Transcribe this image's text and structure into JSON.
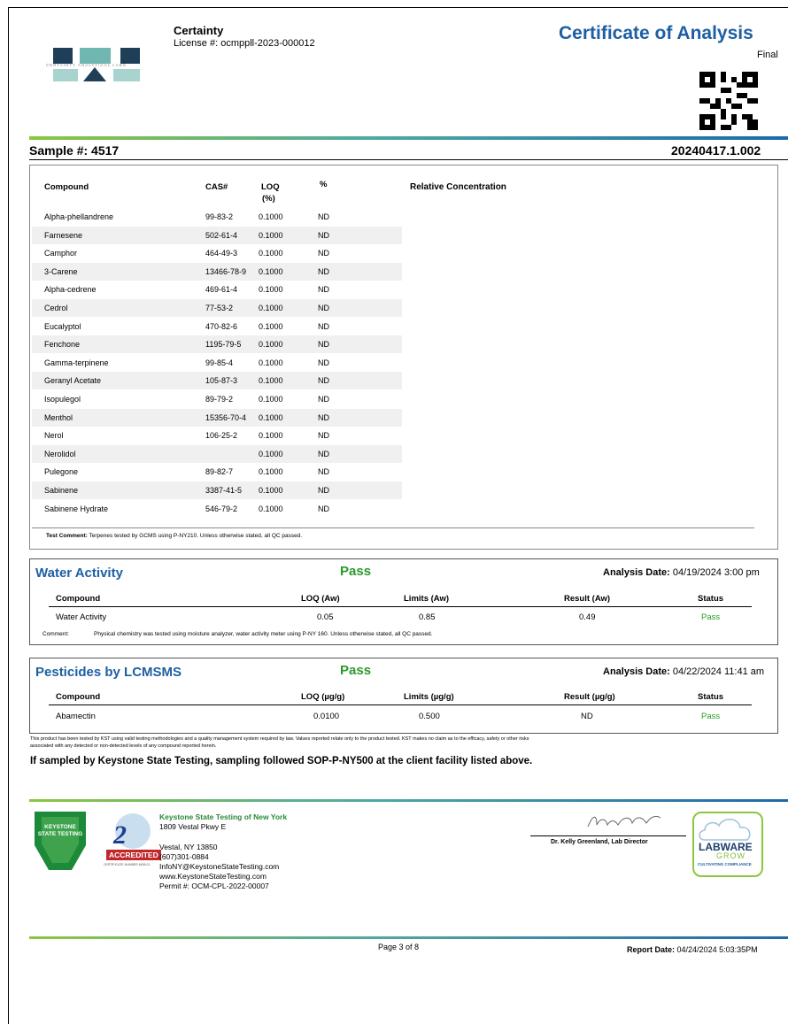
{
  "header": {
    "lab_short": "Certainty",
    "license": "License #: ocmppll-2023-000012",
    "logo_caption": "CERTAINTY ANALYTICAL LABS",
    "doc_title": "Certificate of Analysis",
    "status": "Final",
    "qr_icon": "qr-code-icon"
  },
  "sample": {
    "label": "Sample #: 4517",
    "id": "20240417.1.002"
  },
  "terpenes": {
    "columns": [
      "Compound",
      "CAS#",
      "LOQ",
      "(%)",
      "%",
      "Relative Concentration"
    ],
    "rows": [
      {
        "compound": "Alpha-phellandrene",
        "cas": "99-83-2",
        "loq": "0.1000",
        "pct": "ND"
      },
      {
        "compound": "Farnesene",
        "cas": "502-61-4",
        "loq": "0.1000",
        "pct": "ND"
      },
      {
        "compound": "Camphor",
        "cas": "464-49-3",
        "loq": "0.1000",
        "pct": "ND"
      },
      {
        "compound": "3-Carene",
        "cas": "13466-78-9",
        "loq": "0.1000",
        "pct": "ND"
      },
      {
        "compound": "Alpha-cedrene",
        "cas": "469-61-4",
        "loq": "0.1000",
        "pct": "ND"
      },
      {
        "compound": "Cedrol",
        "cas": "77-53-2",
        "loq": "0.1000",
        "pct": "ND"
      },
      {
        "compound": "Eucalyptol",
        "cas": "470-82-6",
        "loq": "0.1000",
        "pct": "ND"
      },
      {
        "compound": "Fenchone",
        "cas": "1195-79-5",
        "loq": "0.1000",
        "pct": "ND"
      },
      {
        "compound": "Gamma-terpinene",
        "cas": "99-85-4",
        "loq": "0.1000",
        "pct": "ND"
      },
      {
        "compound": "Geranyl Acetate",
        "cas": "105-87-3",
        "loq": "0.1000",
        "pct": "ND"
      },
      {
        "compound": "Isopulegol",
        "cas": "89-79-2",
        "loq": "0.1000",
        "pct": "ND"
      },
      {
        "compound": "Menthol",
        "cas": "15356-70-4",
        "loq": "0.1000",
        "pct": "ND"
      },
      {
        "compound": "Nerol",
        "cas": "106-25-2",
        "loq": "0.1000",
        "pct": "ND"
      },
      {
        "compound": "Nerolidol",
        "cas": "",
        "loq": "0.1000",
        "pct": "ND"
      },
      {
        "compound": "Pulegone",
        "cas": "89-82-7",
        "loq": "0.1000",
        "pct": "ND"
      },
      {
        "compound": "Sabinene",
        "cas": "3387-41-5",
        "loq": "0.1000",
        "pct": "ND"
      },
      {
        "compound": "Sabinene Hydrate",
        "cas": "546-79-2",
        "loq": "0.1000",
        "pct": "ND"
      }
    ],
    "comment_label": "Test Comment:",
    "comment": "Terpenes tested by GCMS using P-NY210. Unless otherwise stated, all QC passed."
  },
  "water": {
    "title": "Water Activity",
    "result": "Pass",
    "date_label": "Analysis Date:",
    "date": "04/19/2024  3:00 pm",
    "columns": [
      "Compound",
      "LOQ (Aw)",
      "Limits (Aw)",
      "Result (Aw)",
      "Status"
    ],
    "row": {
      "compound": "Water Activity",
      "loq": "0.05",
      "limit": "0.85",
      "result": "0.49",
      "status": "Pass"
    },
    "comment_label": "Comment:",
    "comment": "Physical chemistry was tested using moisture analyzer, water activity meter using P-NY 160. Unless otherwise stated, all QC passed."
  },
  "pesticides": {
    "title": "Pesticides by LCMSMS",
    "result": "Pass",
    "date_label": "Analysis Date:",
    "date": "04/22/2024  11:41 am",
    "columns": [
      "Compound",
      "LOQ (µg/g)",
      "Limits (µg/g)",
      "Result (µg/g)",
      "Status"
    ],
    "row": {
      "compound": "Abamectin",
      "loq": "0.0100",
      "limit": "0.500",
      "result": "ND",
      "status": "Pass"
    }
  },
  "disclaimer": {
    "line1": "This product has been tested by KST using valid testing methodologies and a quality management system required by law. Values reported relate only to the product tested. KST makes no claim as to the efficacy, safety or other risks",
    "line2": "associated with any detected or non-detected levels of any compound reported herein.",
    "sop": "If sampled by Keystone State Testing, sampling followed SOP-P-NY500 at the client facility listed above."
  },
  "footer": {
    "keystone_logo": "KEYSTONE STATE TESTING",
    "a2la_label": "ACCREDITED",
    "a2la_sub": "CERTIFICATE NUMBER 6455.01",
    "lab_name": "Keystone State Testing of New York",
    "address1": "1809 Vestal Pkwy E",
    "address2": "Vestal, NY  13850",
    "phone": "(607)301-0884",
    "email": "InfoNY@KeystoneStateTesting.com",
    "website": "www.KeystoneStateTesting.com",
    "permit": "Permit #: OCM-CPL-2022-00007",
    "director": "Dr. Kelly Greenland, Lab Director",
    "labware_main": "LABWARE",
    "labware_sub": "GROW",
    "labware_tag": "CULTIVATING COMPLIANCE",
    "page": "Page 3 of 8",
    "report_label": "Report Date:",
    "report_date": "04/24/2024  5:03:35PM"
  }
}
